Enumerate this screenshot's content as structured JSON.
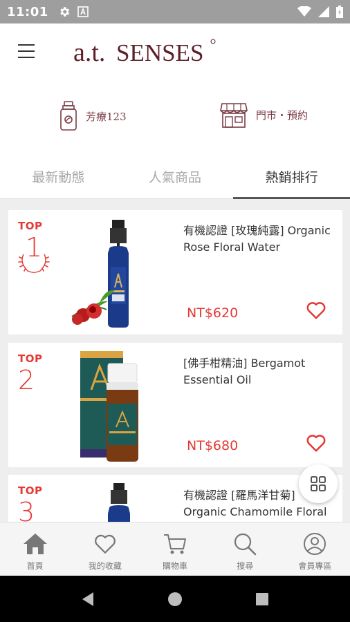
{
  "status_bar": {
    "time": "11:01"
  },
  "header": {
    "brand": "a.t.SENSES",
    "brand_prefix": "a.t.",
    "brand_suffix": "SENSES",
    "brand_color": "#5d1f28"
  },
  "quick_links": [
    {
      "label": "芳療123",
      "icon": "essential-oil-bottle-icon"
    },
    {
      "label": "門市‧預約",
      "icon": "storefront-icon"
    }
  ],
  "tabs": [
    {
      "label": "最新動態",
      "active": false
    },
    {
      "label": "人氣商品",
      "active": false
    },
    {
      "label": "熱銷排行",
      "active": true
    }
  ],
  "products": [
    {
      "rank_label": "TOP",
      "rank": "1",
      "name": "有機認證 [玫瑰純露] Organic Rose Floral Water",
      "price": "NT$620"
    },
    {
      "rank_label": "TOP",
      "rank": "2",
      "name": "[佛手柑精油] Bergamot Essential Oil",
      "price": "NT$680"
    },
    {
      "rank_label": "TOP",
      "rank": "3",
      "name": "有機認證 [羅馬洋甘菊] Organic Chamomile Floral",
      "price": ""
    }
  ],
  "bottom_nav": [
    {
      "label": "首頁",
      "icon": "home-icon"
    },
    {
      "label": "我的收藏",
      "icon": "heart-icon"
    },
    {
      "label": "購物車",
      "icon": "cart-icon"
    },
    {
      "label": "搜尋",
      "icon": "search-icon"
    },
    {
      "label": "會員專區",
      "icon": "user-icon"
    }
  ],
  "colors": {
    "accent": "#e53935",
    "brand": "#5d1f28",
    "icon_brown": "#7a3b44"
  }
}
